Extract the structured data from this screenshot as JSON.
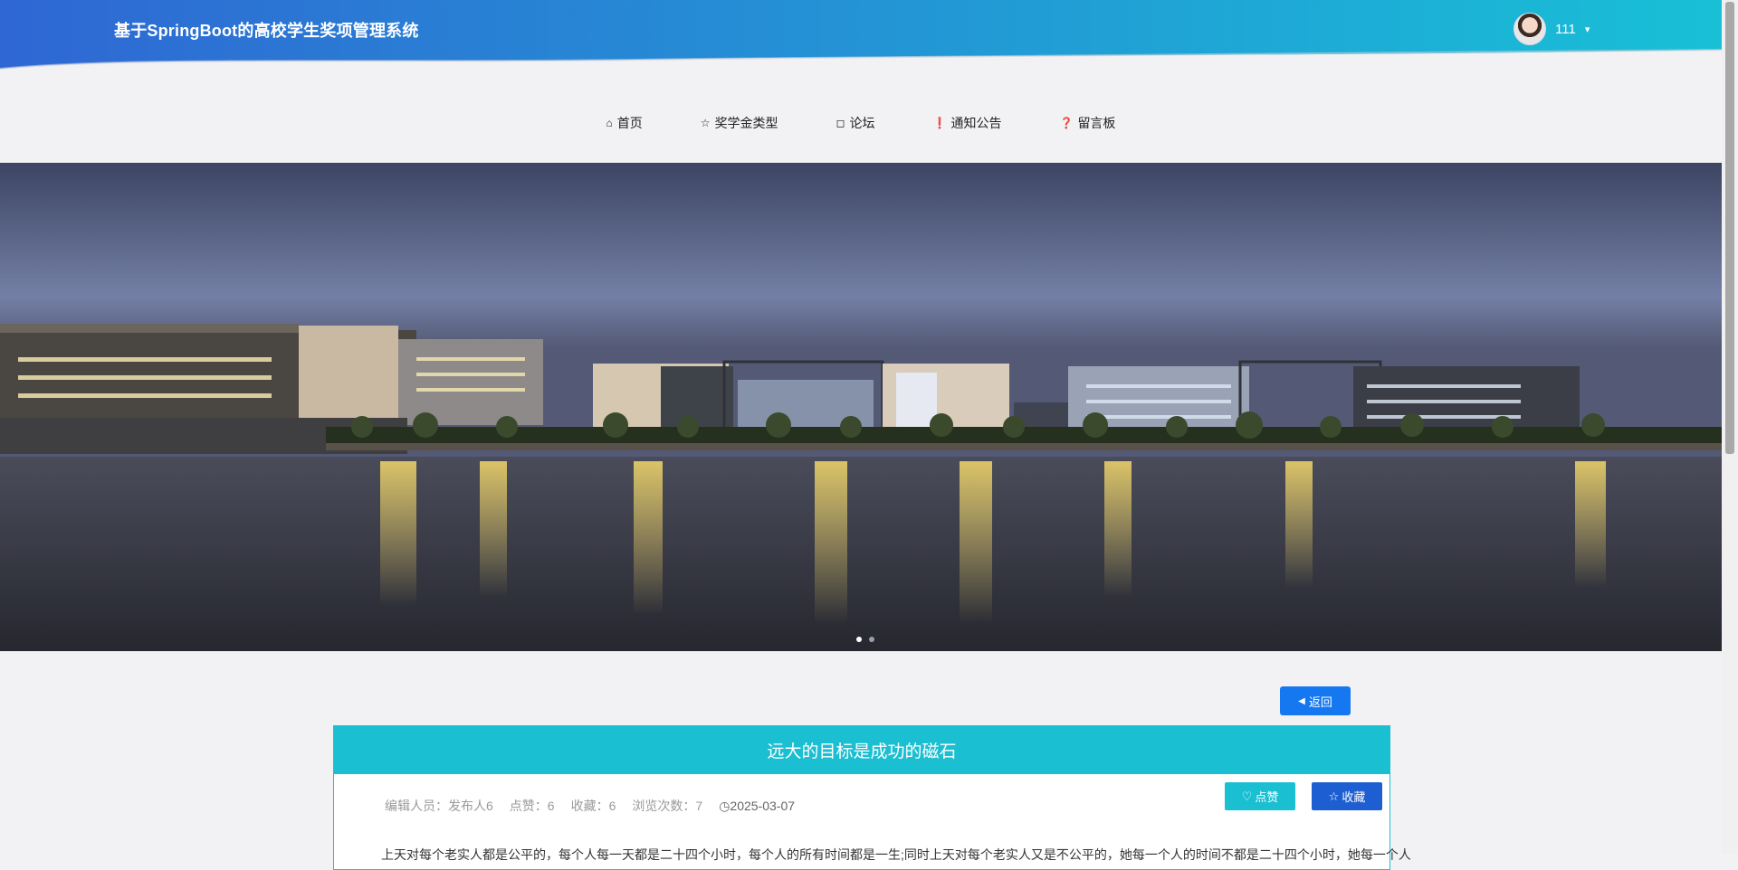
{
  "header": {
    "site_title": "基于SpringBoot的高校学生奖项管理系统",
    "username": "111",
    "caret": "▾"
  },
  "nav": [
    {
      "label": "首页",
      "icon": "home-icon",
      "glyph": "⌂"
    },
    {
      "label": "奖学金类型",
      "icon": "star-icon",
      "glyph": "☆"
    },
    {
      "label": "论坛",
      "icon": "bag-icon",
      "glyph": "◻"
    },
    {
      "label": "通知公告",
      "icon": "alert-icon",
      "glyph": "❗"
    },
    {
      "label": "留言板",
      "icon": "question-icon",
      "glyph": "❓"
    }
  ],
  "banner": {
    "slides": 2,
    "active_slide": 1
  },
  "back_button": {
    "label": "返回",
    "glyph": "◀"
  },
  "article": {
    "title": "远大的目标是成功的磁石",
    "editor": "编辑人员：发布人6",
    "likes": "点赞：6",
    "favorites": "收藏：6",
    "views": "浏览次数：7",
    "date": "2025-03-07",
    "like_label": "点赞",
    "favorite_label": "收藏",
    "content_preview": "上天对每个老实人都是公平的，每个人每一天都是二十四个小时，每个人的所有时间都是一生;同时上天对每个老实人又是不公平的，她每一个人的时间不都是二十四个小时，她每一个人"
  },
  "colors": {
    "header_gradient_start": "#2f67d4",
    "header_gradient_end": "#18c0d6",
    "accent_cyan": "#1bbfd2",
    "back_blue": "#1578f0",
    "fav_blue": "#1d5fd2"
  }
}
